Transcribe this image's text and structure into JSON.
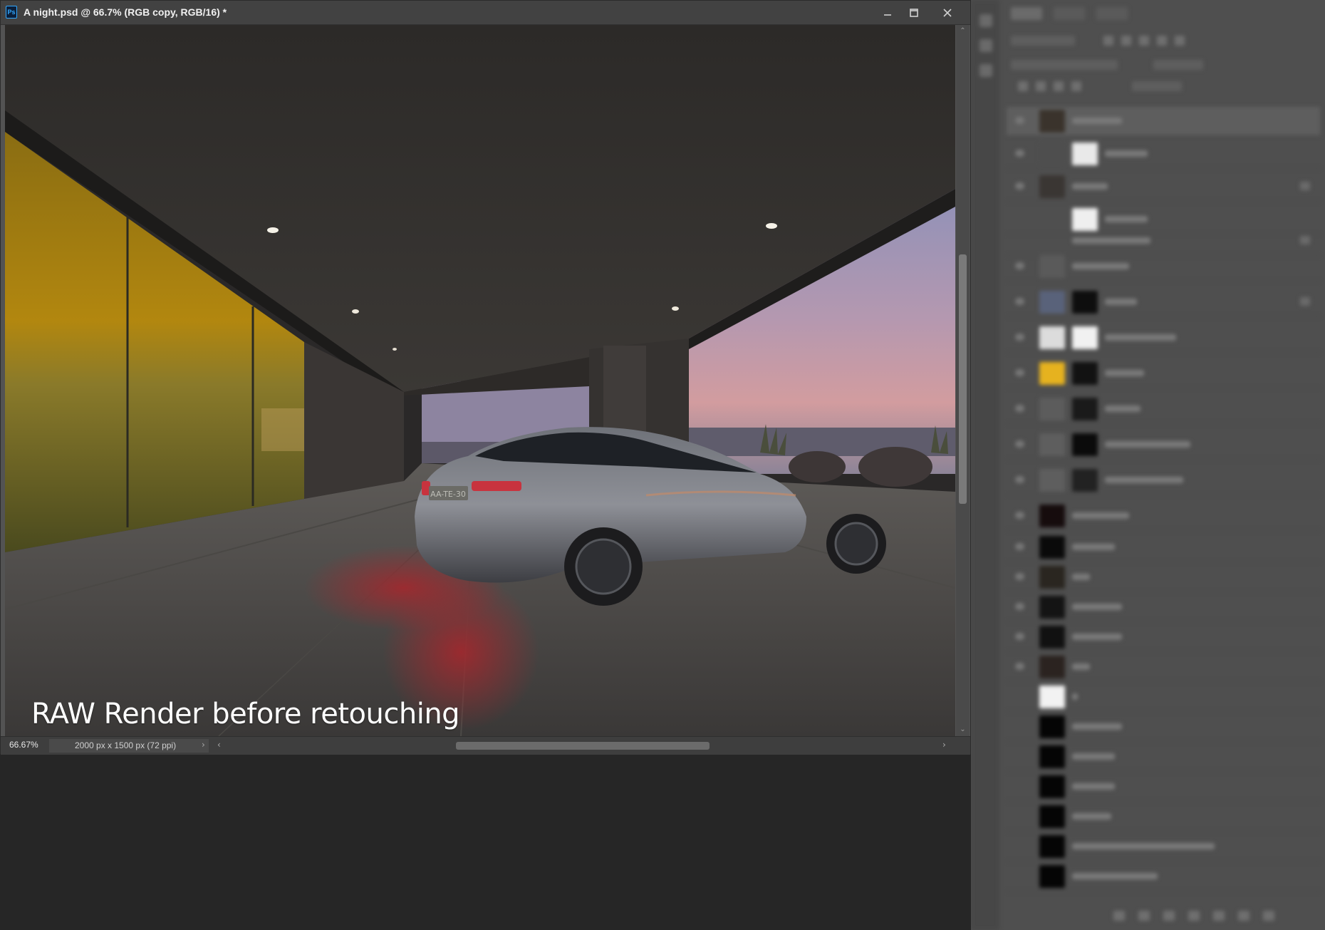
{
  "document": {
    "title": "A night.psd @ 66.7% (RGB copy, RGB/16) *",
    "app_badge": "Ps",
    "caption": "RAW Render before retouching",
    "license_plate": "AA-TE-30"
  },
  "window_controls": {
    "minimize_icon": "minimize-icon",
    "maximize_icon": "restore-icon",
    "close_icon": "close-icon"
  },
  "statusbar": {
    "zoom": "66.67%",
    "doc_info": "2000 px x 1500 px (72 ppi)",
    "info_arrow": "›",
    "scroll_left": "‹",
    "scroll_right": "›"
  },
  "scrollbar": {
    "up": "⌃",
    "down": "⌄"
  },
  "colors": {
    "app_background": "#262626",
    "titlebar": "#424242",
    "panel": "#4f4f4f",
    "accent": "#31a8ff"
  }
}
